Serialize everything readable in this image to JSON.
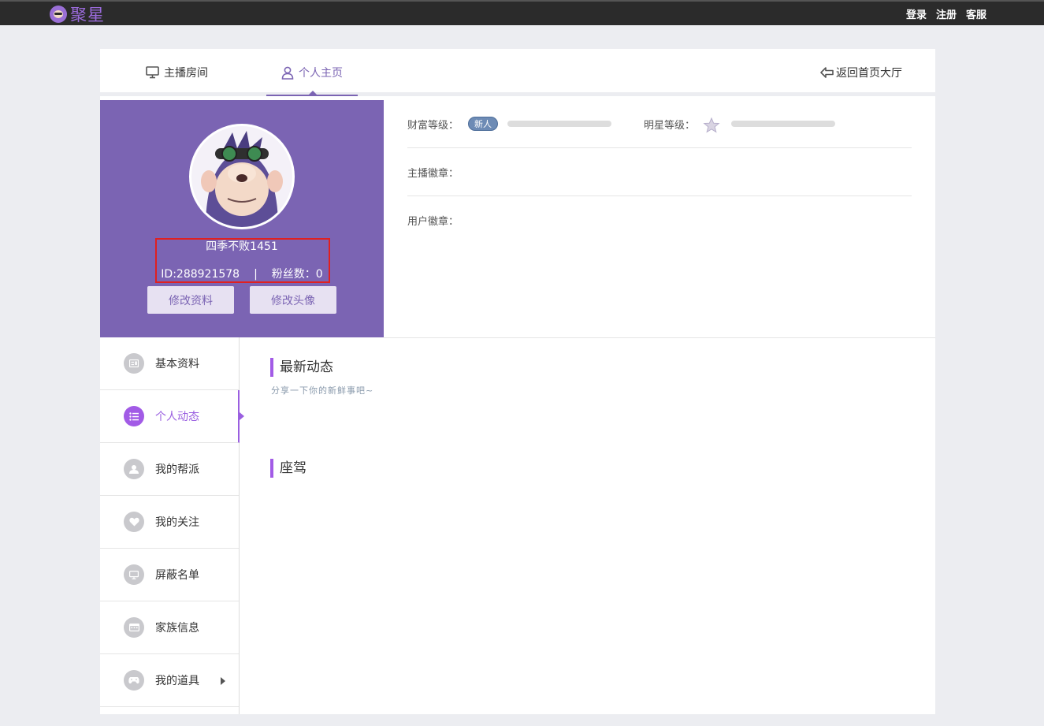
{
  "header": {
    "logo_text": "聚星",
    "links": [
      "登录",
      "注册",
      "客服"
    ]
  },
  "tabs": {
    "room": "主播房间",
    "home": "个人主页",
    "back": "返回首页大厅"
  },
  "profile": {
    "nickname": "四季不败1451",
    "id_text": "ID:288921578",
    "separator": "|",
    "fans_text": "粉丝数：0",
    "edit_profile": "修改资料",
    "edit_avatar": "修改头像"
  },
  "levels": {
    "wealth_label": "财富等级：",
    "wealth_badge": "新人",
    "star_label": "明星等级：",
    "anchor_badge_label": "主播徽章：",
    "user_badge_label": "用户徽章："
  },
  "sidebar": {
    "items": [
      {
        "label": "基本资料",
        "icon": "profile-card-icon"
      },
      {
        "label": "个人动态",
        "icon": "list-icon"
      },
      {
        "label": "我的帮派",
        "icon": "group-icon"
      },
      {
        "label": "我的关注",
        "icon": "heart-icon"
      },
      {
        "label": "屏蔽名单",
        "icon": "monitor-icon"
      },
      {
        "label": "家族信息",
        "icon": "calendar-icon"
      },
      {
        "label": "我的道具",
        "icon": "gamepad-icon"
      }
    ],
    "active_index": 1
  },
  "content": {
    "latest_title": "最新动态",
    "latest_hint": "分享一下你的新鲜事吧~",
    "mount_title": "座驾"
  },
  "colors": {
    "accent": "#7b64b3",
    "active": "#a25be6",
    "topbar": "#2b2b2b"
  }
}
